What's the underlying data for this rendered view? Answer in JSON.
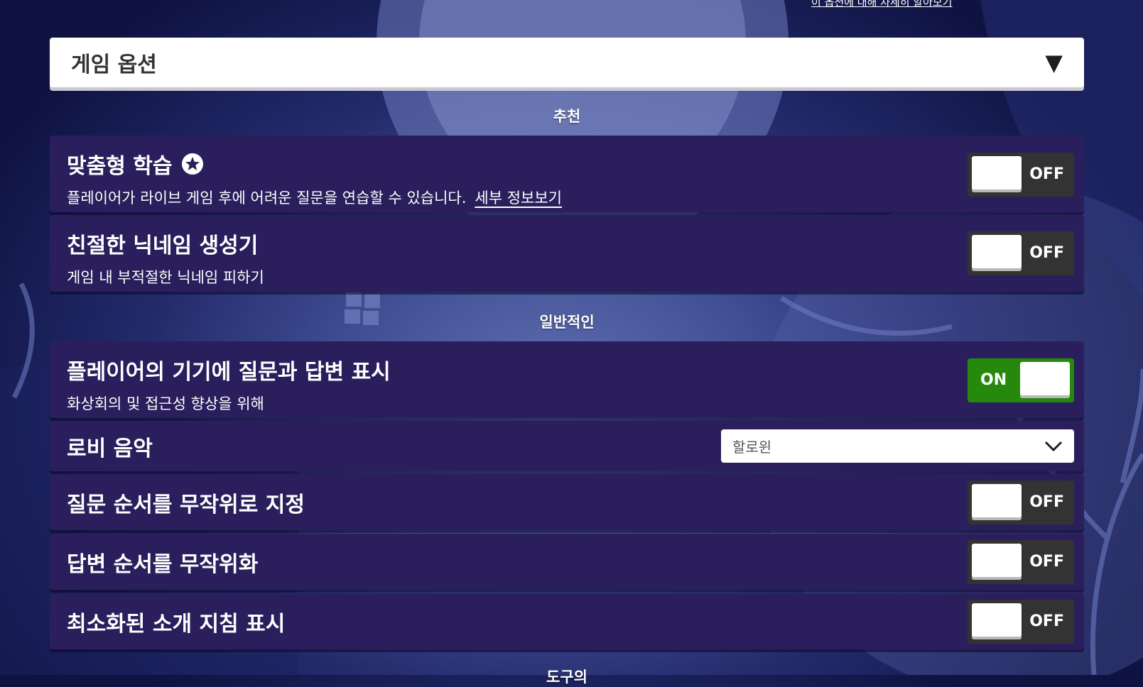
{
  "top_link": "이 옵션에 대해 자세히 알아보기",
  "header": {
    "title": "게임 옵션",
    "toggle_icon": "triangle-down-icon"
  },
  "sections": {
    "recommended": "추천",
    "general": "일반적인",
    "next_partial": "도구의"
  },
  "settings": {
    "smart_practice": {
      "title": "맞춤형 학습",
      "description": "플레이어가 라이브 게임 후에 어려운 질문을 연습할 수 있습니다.",
      "link": "세부 정보보기",
      "badge_icon": "star-icon",
      "state": "OFF"
    },
    "friendly_nickname": {
      "title": "친절한 닉네임 생성기",
      "description": "게임 내 부적절한 닉네임 피하기",
      "state": "OFF"
    },
    "show_on_devices": {
      "title": "플레이어의 기기에 질문과 답변 표시",
      "description": "화상회의 및 접근성 향상을 위해",
      "state": "ON"
    },
    "lobby_music": {
      "title": "로비 음악",
      "selected": "할로윈"
    },
    "randomize_questions": {
      "title": "질문 순서를 무작위로 지정",
      "state": "OFF"
    },
    "randomize_answers": {
      "title": "답변 순서를 무작위화",
      "state": "OFF"
    },
    "minimized_intro": {
      "title": "최소화된 소개 지침 표시",
      "state": "OFF"
    }
  },
  "colors": {
    "card_bg": "#2a1f5c",
    "toggle_off": "#333333",
    "toggle_on": "#26890c",
    "background": "#3f4c91"
  }
}
